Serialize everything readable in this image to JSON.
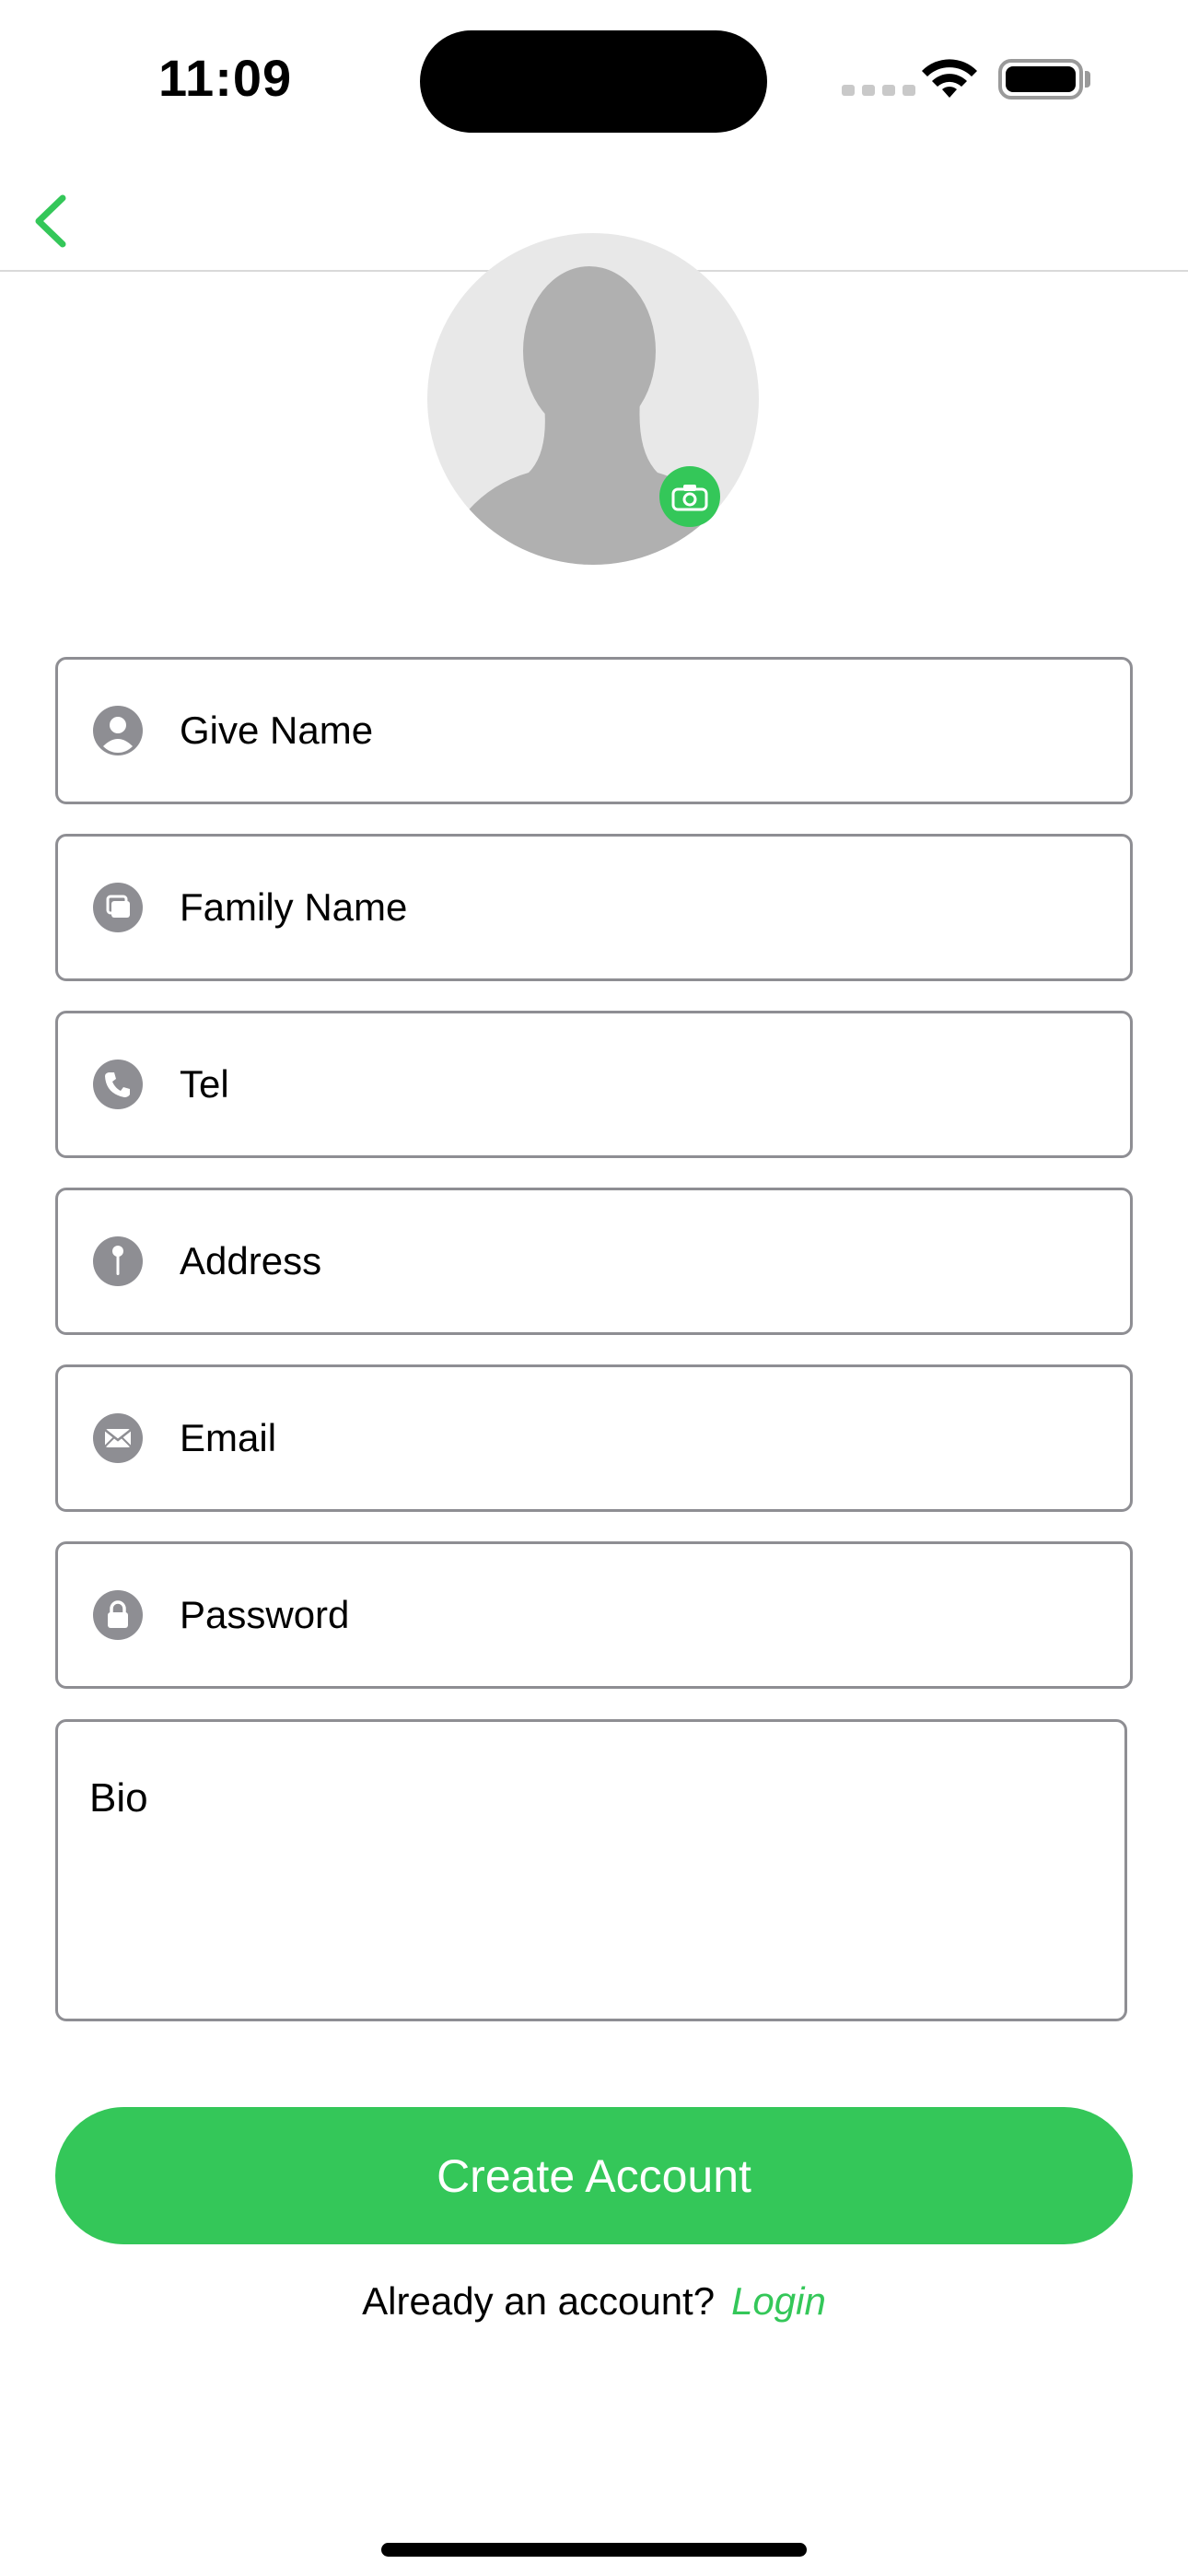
{
  "status_bar": {
    "time": "11:09",
    "wifi_icon": "wifi-icon",
    "battery_icon": "battery-icon",
    "signal_icon": "signal-dots-icon"
  },
  "nav": {
    "back_icon": "chevron-left-icon"
  },
  "avatar": {
    "placeholder_icon": "person-silhouette-icon",
    "badge_icon": "camera-icon"
  },
  "form": {
    "fields": [
      {
        "label": "Give Name",
        "icon": "person-circle-icon"
      },
      {
        "label": "Family Name",
        "icon": "square-stack-icon"
      },
      {
        "label": "Tel",
        "icon": "phone-icon"
      },
      {
        "label": "Address",
        "icon": "pin-icon"
      },
      {
        "label": "Email",
        "icon": "envelope-icon"
      },
      {
        "label": "Password",
        "icon": "lock-icon"
      }
    ],
    "bio_label": "Bio"
  },
  "actions": {
    "create_account_label": "Create Account"
  },
  "footer": {
    "prompt": "Already an account?",
    "login_label": "Login"
  },
  "colors": {
    "accent": "#34c759",
    "field_border": "#8e8e93",
    "icon_gray": "#8e8e93",
    "avatar_bg": "#e8e8e8",
    "silhouette": "#b0b0b0"
  }
}
